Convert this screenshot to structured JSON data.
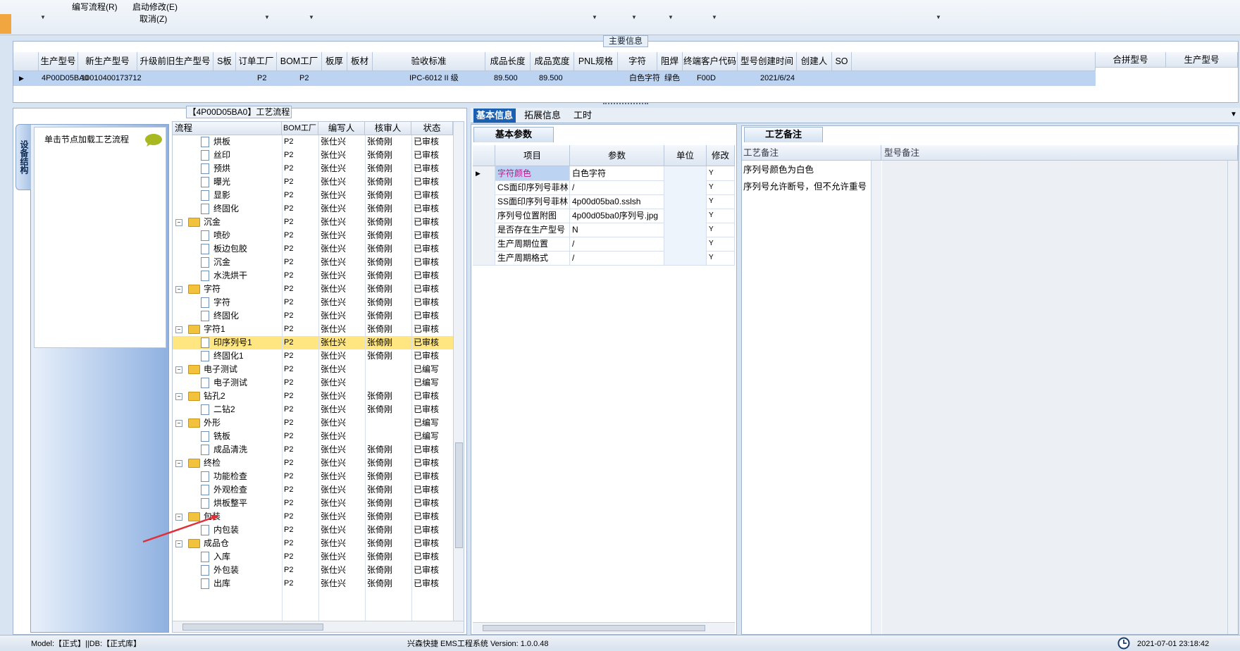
{
  "ribbon": {
    "menu_items": [
      "编写流程(R)",
      "启动修改(E)",
      "取消(Z)"
    ]
  },
  "main_info": {
    "title": "主要信息",
    "columns": [
      "生产型号",
      "新生产型号",
      "升级前旧生产型号",
      "S板",
      "订单工厂",
      "BOM工厂",
      "板厚",
      "板材",
      "验收标准",
      "成品长度",
      "成品宽度",
      "PNL规格",
      "字符",
      "阻焊",
      "终端客户代码",
      "型号创建时间",
      "创建人",
      "SO"
    ],
    "right_columns": [
      "合拼型号",
      "生产型号"
    ],
    "row": {
      "model": "4P00D05BA0",
      "new_model": "10010400173712",
      "old_model": "",
      "s_board": "",
      "order_factory": "P2",
      "bom_factory": "P2",
      "thickness": "",
      "material": "",
      "standard": "IPC-6012 II 级",
      "length": "89.500",
      "width": "89.500",
      "pnl": "",
      "char": "白色字符",
      "mask": "绿色",
      "customer": "F00D",
      "created": "2021/6/24",
      "creator": "",
      "so": ""
    }
  },
  "flow": {
    "title": "【4P00D05BA0】工艺流程",
    "sidebar_tab": "设备结构",
    "sidebar_hint": "单击节点加载工艺流程",
    "columns": [
      "流程",
      "BOM工厂",
      "编写人",
      "核审人",
      "状态"
    ],
    "rows": [
      {
        "name": "烘板",
        "level": 2,
        "bom": "P2",
        "writer": "张仕兴",
        "reviewer": "张倚刚",
        "status": "已审核"
      },
      {
        "name": "丝印",
        "level": 2,
        "bom": "P2",
        "writer": "张仕兴",
        "reviewer": "张倚刚",
        "status": "已审核"
      },
      {
        "name": "预烘",
        "level": 2,
        "bom": "P2",
        "writer": "张仕兴",
        "reviewer": "张倚刚",
        "status": "已审核"
      },
      {
        "name": "曝光",
        "level": 2,
        "bom": "P2",
        "writer": "张仕兴",
        "reviewer": "张倚刚",
        "status": "已审核"
      },
      {
        "name": "显影",
        "level": 2,
        "bom": "P2",
        "writer": "张仕兴",
        "reviewer": "张倚刚",
        "status": "已审核"
      },
      {
        "name": "终固化",
        "level": 2,
        "bom": "P2",
        "writer": "张仕兴",
        "reviewer": "张倚刚",
        "status": "已审核"
      },
      {
        "name": "沉金",
        "level": 1,
        "bom": "P2",
        "writer": "张仕兴",
        "reviewer": "张倚刚",
        "status": "已审核"
      },
      {
        "name": "喷砂",
        "level": 2,
        "bom": "P2",
        "writer": "张仕兴",
        "reviewer": "张倚刚",
        "status": "已审核"
      },
      {
        "name": "板边包胶",
        "level": 2,
        "bom": "P2",
        "writer": "张仕兴",
        "reviewer": "张倚刚",
        "status": "已审核"
      },
      {
        "name": "沉金",
        "level": 2,
        "bom": "P2",
        "writer": "张仕兴",
        "reviewer": "张倚刚",
        "status": "已审核"
      },
      {
        "name": "水洗烘干",
        "level": 2,
        "bom": "P2",
        "writer": "张仕兴",
        "reviewer": "张倚刚",
        "status": "已审核"
      },
      {
        "name": "字符",
        "level": 1,
        "bom": "P2",
        "writer": "张仕兴",
        "reviewer": "张倚刚",
        "status": "已审核"
      },
      {
        "name": "字符",
        "level": 2,
        "bom": "P2",
        "writer": "张仕兴",
        "reviewer": "张倚刚",
        "status": "已审核"
      },
      {
        "name": "终固化",
        "level": 2,
        "bom": "P2",
        "writer": "张仕兴",
        "reviewer": "张倚刚",
        "status": "已审核"
      },
      {
        "name": "字符1",
        "level": 1,
        "bom": "P2",
        "writer": "张仕兴",
        "reviewer": "张倚刚",
        "status": "已审核"
      },
      {
        "name": "印序列号1",
        "level": 2,
        "bom": "P2",
        "writer": "张仕兴",
        "reviewer": "张倚刚",
        "status": "已审核",
        "highlight": true
      },
      {
        "name": "终固化1",
        "level": 2,
        "bom": "P2",
        "writer": "张仕兴",
        "reviewer": "张倚刚",
        "status": "已审核"
      },
      {
        "name": "电子测试",
        "level": 1,
        "bom": "P2",
        "writer": "张仕兴",
        "reviewer": "",
        "status": "已编写"
      },
      {
        "name": "电子测试",
        "level": 2,
        "bom": "P2",
        "writer": "张仕兴",
        "reviewer": "",
        "status": "已编写"
      },
      {
        "name": "钻孔2",
        "level": 1,
        "bom": "P2",
        "writer": "张仕兴",
        "reviewer": "张倚刚",
        "status": "已审核"
      },
      {
        "name": "二钻2",
        "level": 2,
        "bom": "P2",
        "writer": "张仕兴",
        "reviewer": "张倚刚",
        "status": "已审核"
      },
      {
        "name": "外形",
        "level": 1,
        "bom": "P2",
        "writer": "张仕兴",
        "reviewer": "",
        "status": "已编写"
      },
      {
        "name": "铣板",
        "level": 2,
        "bom": "P2",
        "writer": "张仕兴",
        "reviewer": "",
        "status": "已编写"
      },
      {
        "name": "成品清洗",
        "level": 2,
        "bom": "P2",
        "writer": "张仕兴",
        "reviewer": "张倚刚",
        "status": "已审核"
      },
      {
        "name": "终检",
        "level": 1,
        "bom": "P2",
        "writer": "张仕兴",
        "reviewer": "张倚刚",
        "status": "已审核"
      },
      {
        "name": "功能检查",
        "level": 2,
        "bom": "P2",
        "writer": "张仕兴",
        "reviewer": "张倚刚",
        "status": "已审核"
      },
      {
        "name": "外观检查",
        "level": 2,
        "bom": "P2",
        "writer": "张仕兴",
        "reviewer": "张倚刚",
        "status": "已审核"
      },
      {
        "name": "烘板整平",
        "level": 2,
        "bom": "P2",
        "writer": "张仕兴",
        "reviewer": "张倚刚",
        "status": "已审核"
      },
      {
        "name": "包装",
        "level": 1,
        "bom": "P2",
        "writer": "张仕兴",
        "reviewer": "张倚刚",
        "status": "已审核"
      },
      {
        "name": "内包装",
        "level": 2,
        "bom": "P2",
        "writer": "张仕兴",
        "reviewer": "张倚刚",
        "status": "已审核"
      },
      {
        "name": "成品仓",
        "level": 1,
        "bom": "P2",
        "writer": "张仕兴",
        "reviewer": "张倚刚",
        "status": "已审核"
      },
      {
        "name": "入库",
        "level": 2,
        "bom": "P2",
        "writer": "张仕兴",
        "reviewer": "张倚刚",
        "status": "已审核"
      },
      {
        "name": "外包装",
        "level": 2,
        "bom": "P2",
        "writer": "张仕兴",
        "reviewer": "张倚刚",
        "status": "已审核"
      },
      {
        "name": "出库",
        "level": 2,
        "bom": "P2",
        "writer": "张仕兴",
        "reviewer": "张倚刚",
        "status": "已审核"
      }
    ]
  },
  "tabs": [
    "基本信息",
    "拓展信息",
    "工时"
  ],
  "basic_params": {
    "title": "基本参数",
    "columns": [
      "项目",
      "参数",
      "单位",
      "修改"
    ],
    "rows": [
      {
        "item": "字符颜色",
        "value": "白色字符",
        "unit": "",
        "mod": "Y"
      },
      {
        "item": "CS面印序列号菲林",
        "value": "/",
        "unit": "",
        "mod": "Y"
      },
      {
        "item": "SS面印序列号菲林",
        "value": "4p00d05ba0.sslsh",
        "unit": "",
        "mod": "Y"
      },
      {
        "item": "序列号位置附图",
        "value": "4p00d05ba0序列号.jpg",
        "unit": "",
        "mod": "Y"
      },
      {
        "item": "是否存在生产型号",
        "value": "N",
        "unit": "",
        "mod": "Y"
      },
      {
        "item": "生产周期位置",
        "value": "/",
        "unit": "",
        "mod": "Y"
      },
      {
        "item": "生产周期格式",
        "value": "/",
        "unit": "",
        "mod": "Y"
      }
    ]
  },
  "notes": {
    "title": "工艺备注",
    "col1": "工艺备注",
    "col2": "型号备注",
    "lines": [
      "序列号颜色为白色",
      "序列号允许断号，但不允许重号"
    ]
  },
  "status_bar": {
    "left": "Model:【正式】||DB:【正式库】",
    "center": "兴森快捷 EMS工程系统 Version: 1.0.0.48",
    "right": "2021-07-01 23:18:42"
  },
  "colors": {
    "accent": "#1b5fb0",
    "highlight": "#ffe680",
    "selected_row": "#bcd3f1",
    "annotation_arrow": "#e0303a"
  }
}
